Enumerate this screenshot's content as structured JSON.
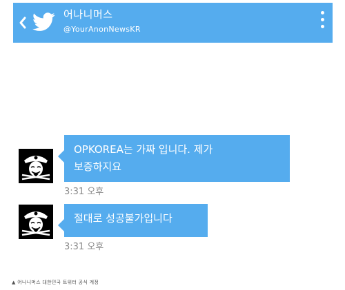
{
  "header": {
    "title": "어나니머스",
    "handle": "@YourAnonNewsKR",
    "back_icon": "chevron-left-icon",
    "logo_icon": "twitter-bird-icon",
    "menu_icon": "more-vertical-icon",
    "bar_color": "#55acee"
  },
  "messages": [
    {
      "text_line1": "OPKOREA는 가짜 입니다. 제가",
      "text_line2": "보증하지요",
      "time": "3:31 오후"
    },
    {
      "text_line1": "절대로 성공불가입니다",
      "time": "3:31 오후"
    }
  ],
  "caption": "▲ 어나니머스 대한민국 트위터 공식 계정"
}
